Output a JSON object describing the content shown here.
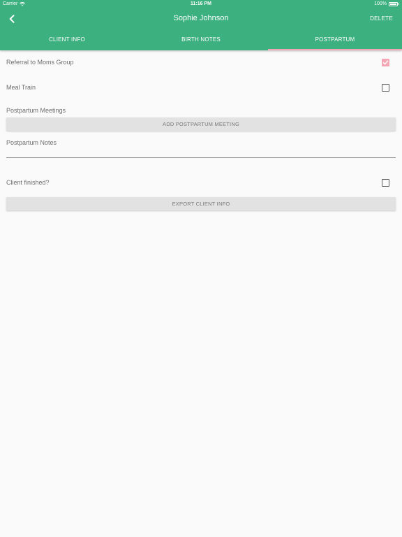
{
  "status_bar": {
    "carrier": "Carrier",
    "time": "11:16 PM",
    "battery": "100%"
  },
  "nav": {
    "title": "Sophie Johnson",
    "delete_label": "DELETE",
    "back_icon": "chevron-left-icon"
  },
  "tabs": [
    {
      "label": "CLIENT INFO",
      "active": false
    },
    {
      "label": "BIRTH NOTES",
      "active": false
    },
    {
      "label": "POSTPARTUM",
      "active": true
    }
  ],
  "postpartum": {
    "referral": {
      "label": "Referral to Moms Group",
      "checked": true
    },
    "meal_train": {
      "label": "Meal Train",
      "checked": false
    },
    "meetings_label": "Postpartum Meetings",
    "add_meeting_label": "ADD POSTPARTUM MEETING",
    "notes_label": "Postpartum Notes",
    "notes_value": "",
    "client_finished": {
      "label": "Client finished?",
      "checked": false
    },
    "export_label": "EXPORT CLIENT INFO"
  },
  "colors": {
    "header_bg": "#3cb07e",
    "accent_pink": "#f3a7b4",
    "page_bg": "#fafafa"
  }
}
